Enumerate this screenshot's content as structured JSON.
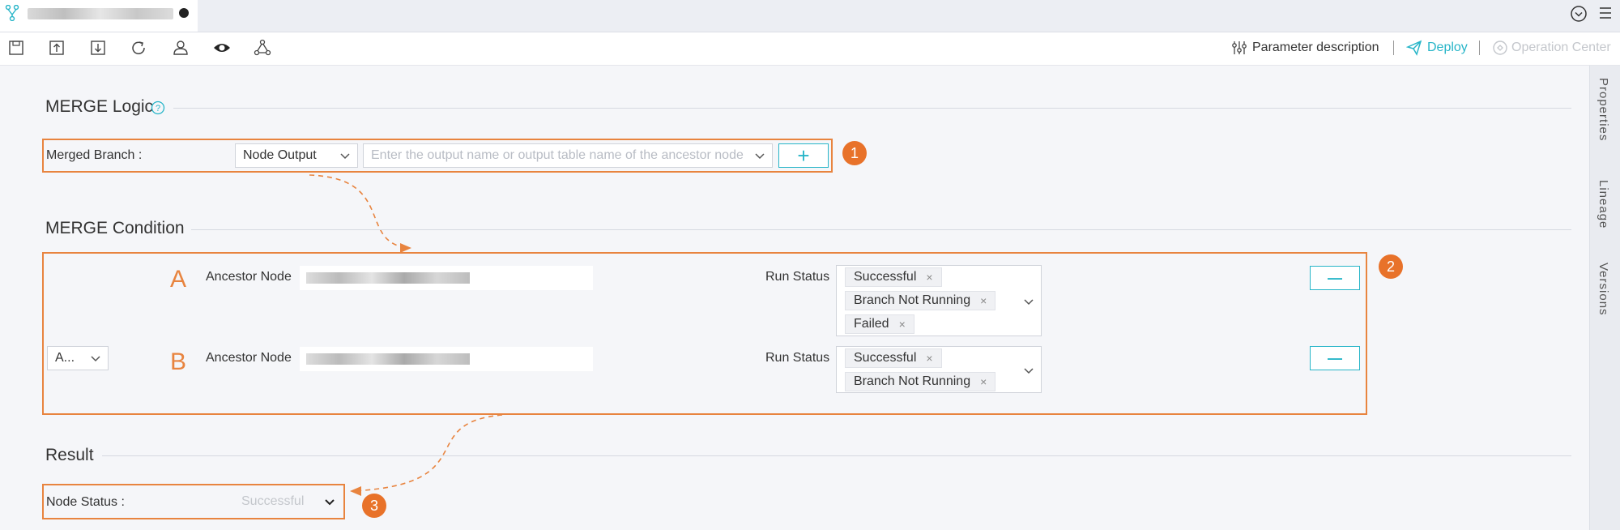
{
  "toolbar": {
    "param_desc": "Parameter description",
    "deploy": "Deploy",
    "op_center": "Operation Center",
    "icons": [
      "save-icon",
      "submit-icon",
      "export-icon",
      "refresh-icon",
      "user-icon",
      "preview-icon",
      "graph-icon"
    ]
  },
  "sidebar": {
    "properties": "Properties",
    "lineage": "Lineage",
    "versions": "Versions"
  },
  "merge_logic": {
    "title": "MERGE Logic",
    "branch_label": "Merged Branch :",
    "type_select": "Node Output",
    "placeholder": "Enter the output name or output table name of the ancestor node",
    "add_label": "+",
    "badge": "1"
  },
  "merge_condition": {
    "title": "MERGE Condition",
    "badge": "2",
    "logic_select": "A...",
    "rows": [
      {
        "letter": "A",
        "ancestor_label": "Ancestor Node",
        "status_label": "Run Status",
        "tags": [
          "Successful",
          "Branch Not Running",
          "Failed"
        ],
        "remove_label": "—"
      },
      {
        "letter": "B",
        "ancestor_label": "Ancestor Node",
        "status_label": "Run Status",
        "tags": [
          "Successful",
          "Branch Not Running"
        ],
        "remove_label": "—"
      }
    ]
  },
  "result": {
    "title": "Result",
    "status_label": "Node Status :",
    "status_value": "Successful",
    "badge": "3"
  },
  "colors": {
    "accent": "#27b5c8",
    "highlight": "#e8843f"
  }
}
